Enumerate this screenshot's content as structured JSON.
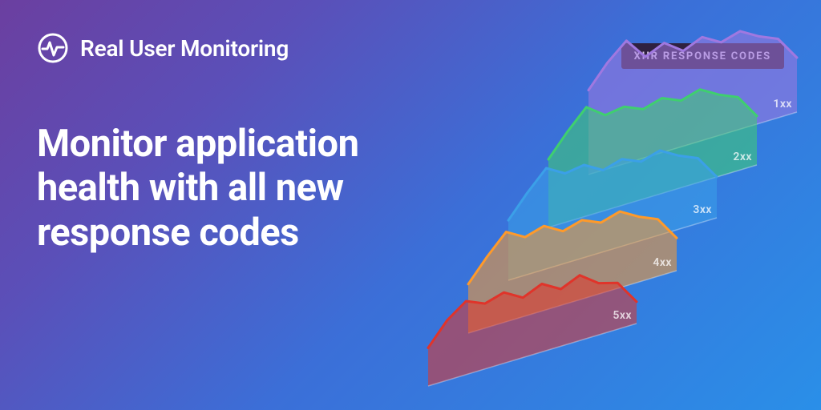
{
  "header": {
    "brand": "Real User Monitoring"
  },
  "headline": "Monitor application health with all new response codes",
  "badge_label": "XHR RESPONSE CODES",
  "chart_data": {
    "type": "area",
    "title": "XHR Response Codes",
    "xlabel": "",
    "ylabel": "",
    "ylim": [
      0,
      100
    ],
    "x": [
      0,
      1,
      2,
      3,
      4,
      5,
      6,
      7,
      8,
      9,
      10,
      11
    ],
    "series": [
      {
        "name": "1xx",
        "color": "#A078E0",
        "values": [
          62,
          78,
          90,
          74,
          80,
          70,
          76,
          68,
          72,
          64,
          58,
          40
        ]
      },
      {
        "name": "2xx",
        "color": "#3FCF6F",
        "values": [
          50,
          66,
          80,
          70,
          72,
          66,
          70,
          64,
          68,
          60,
          54,
          36
        ]
      },
      {
        "name": "3xx",
        "color": "#3BA0E8",
        "values": [
          44,
          60,
          74,
          66,
          68,
          60,
          64,
          58,
          62,
          54,
          48,
          30
        ]
      },
      {
        "name": "4xx",
        "color": "#FF9A2A",
        "values": [
          36,
          52,
          66,
          58,
          62,
          54,
          58,
          52,
          56,
          48,
          42,
          24
        ]
      },
      {
        "name": "5xx",
        "color": "#E0342A",
        "values": [
          28,
          44,
          54,
          48,
          52,
          44,
          50,
          42,
          48,
          38,
          34,
          16
        ]
      }
    ]
  }
}
